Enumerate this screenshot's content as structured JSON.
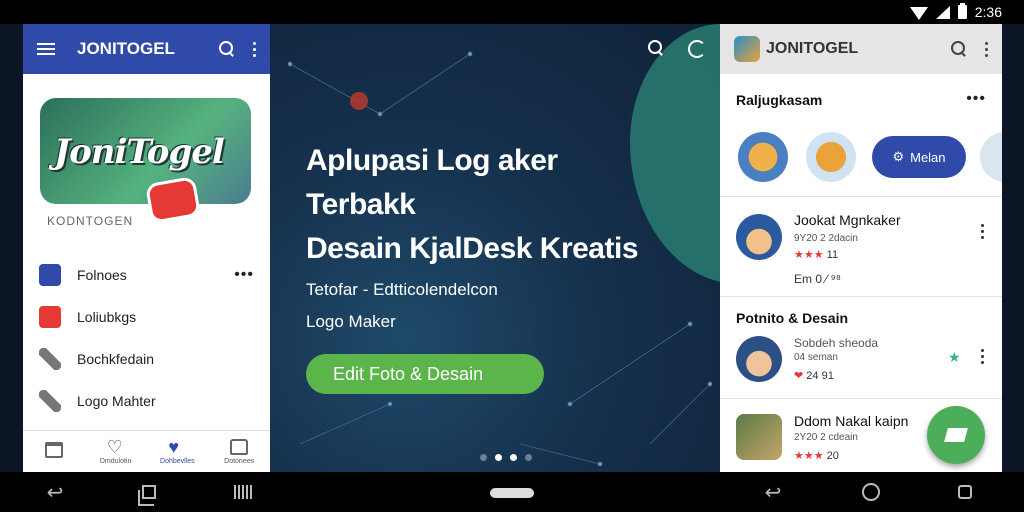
{
  "status": {
    "time": "2:36"
  },
  "left": {
    "app_title": "JONITOGEL",
    "logo_text": "JoniTogel",
    "logo_caption": "KODNTOGEN",
    "menu": [
      {
        "label": "Folnoes",
        "icon": "document-icon",
        "more": "•••"
      },
      {
        "label": "Loliubkgs",
        "icon": "youtube-icon"
      },
      {
        "label": "Bochkfedain",
        "icon": "wrench-icon"
      },
      {
        "label": "Logo Mahter",
        "icon": "wrench-icon"
      }
    ],
    "tabs": [
      {
        "label": "",
        "icon": "calendar-icon"
      },
      {
        "label": "Dmdulotin",
        "icon": "heart-outline-icon"
      },
      {
        "label": "Dohbevlles",
        "icon": "heart-filled-icon"
      },
      {
        "label": "Dotonees",
        "icon": "lock-icon"
      }
    ]
  },
  "hero": {
    "line1": "Aplupasi Log aker",
    "line2": "Terbakk",
    "line3": "Desain KjalDesk Kreatis",
    "sub1": "Tetofar - Edtticolendelcon",
    "sub2": "Logo Maker",
    "cta": "Edit Foto & Desain"
  },
  "right": {
    "app_title": "JONITOGEL",
    "section1": "Raljugkasam",
    "chip_label": "Melan",
    "items": [
      {
        "title": "Jookat Mgnkaker",
        "sub": "9Y20 2 2dacin",
        "rating": "11",
        "meta": "Em  0  ⁄  ⁹⁸"
      },
      {
        "title": "Sobdeh sheoda",
        "sub": "04 seman",
        "rating": "24 91"
      },
      {
        "title": "Ddom Nakal kaipn",
        "sub": "2Y20 2 cdeain",
        "rating": "20"
      }
    ],
    "section2": "Potnito & Desain"
  },
  "colors": {
    "primary": "#2f4aa8",
    "accent": "#5cb54a",
    "danger": "#e53935"
  }
}
